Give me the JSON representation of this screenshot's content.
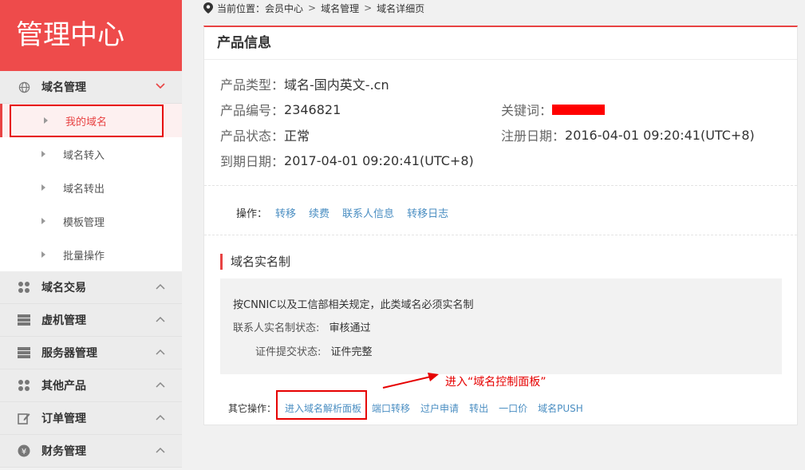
{
  "brand": {
    "title": "管理中心",
    "color": "#ee4b4b"
  },
  "sidebar": {
    "groups": [
      {
        "label": "域名管理",
        "icon": "globe-icon",
        "chevron": "chevron-down-icon",
        "expanded": true
      },
      {
        "label": "域名交易",
        "icon": "grid-icon",
        "chevron": "chevron-up-icon"
      },
      {
        "label": "虚机管理",
        "icon": "server-icon",
        "chevron": "chevron-up-icon"
      },
      {
        "label": "服务器管理",
        "icon": "server-icon",
        "chevron": "chevron-up-icon"
      },
      {
        "label": "其他产品",
        "icon": "grid-icon",
        "chevron": "chevron-up-icon"
      },
      {
        "label": "订单管理",
        "icon": "edit-icon",
        "chevron": "chevron-up-icon"
      },
      {
        "label": "财务管理",
        "icon": "yen-icon",
        "chevron": "chevron-up-icon"
      }
    ],
    "sub_items": [
      {
        "label": "我的域名",
        "active": true
      },
      {
        "label": "域名转入"
      },
      {
        "label": "域名转出"
      },
      {
        "label": "模板管理"
      },
      {
        "label": "批量操作"
      }
    ]
  },
  "breadcrumb": {
    "prefix": "当前位置：",
    "items": [
      "会员中心",
      "域名管理",
      "域名详细页"
    ],
    "separator": ">"
  },
  "product": {
    "title": "产品信息",
    "type_label": "产品类型：",
    "type_value": "域名-国内英文-.cn",
    "id_label": "产品编号：",
    "id_value": "2346821",
    "keyword_label": "关键词：",
    "status_label": "产品状态：",
    "status_value": "正常",
    "reg_label": "注册日期：",
    "reg_value": "2016-04-01 09:20:41(UTC+8)",
    "exp_label": "到期日期：",
    "exp_value": "2017-04-01 09:20:41(UTC+8)"
  },
  "operations": {
    "label": "操作：",
    "links": [
      "转移",
      "续费",
      "联系人信息",
      "转移日志"
    ]
  },
  "realname": {
    "title": "域名实名制",
    "notice": "按CNNIC以及工信部相关规定，此类域名必须实名制",
    "contact_label": "联系人实名制状态:",
    "contact_value": "审核通过",
    "doc_label": "证件提交状态:",
    "doc_value": "证件完整"
  },
  "annotation": {
    "text": "进入“域名控制面板”",
    "color": "#e60000"
  },
  "other_ops": {
    "label": "其它操作：",
    "links": [
      "进入域名解析面板",
      "端口转移",
      "过户申请",
      "转出",
      "一口价",
      "域名PUSH"
    ]
  },
  "colors": {
    "accent": "#e84343",
    "link": "#4a8ec2",
    "highlight_box": "#e60000"
  }
}
